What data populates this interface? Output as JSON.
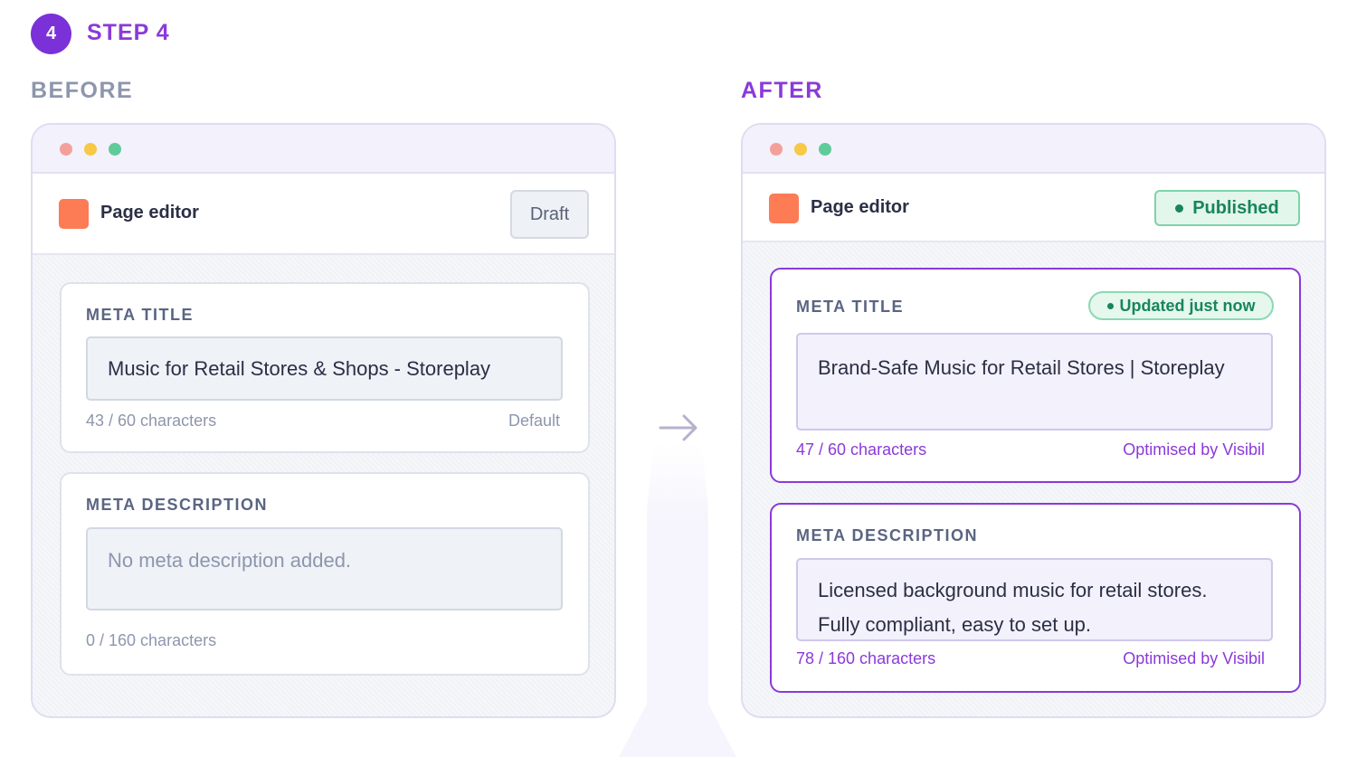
{
  "step": {
    "number": "4",
    "label": "STEP 4"
  },
  "before": {
    "section_label": "BEFORE",
    "editor_title": "Page editor",
    "status": "Draft",
    "meta_title": {
      "label": "META TITLE",
      "value": "Music for Retail Stores & Shops - Storeplay",
      "count": "43 / 60 characters",
      "note": "Default"
    },
    "meta_description": {
      "label": "META DESCRIPTION",
      "placeholder": "No meta description added.",
      "count": "0 / 160 characters"
    }
  },
  "after": {
    "section_label": "AFTER",
    "editor_title": "Page editor",
    "status": "Published",
    "meta_title": {
      "label": "META TITLE",
      "badge": "Updated just now",
      "value": "Brand-Safe Music for Retail Stores | Storeplay",
      "count": "47 / 60 characters",
      "note": "Optimised by Visibil"
    },
    "meta_description": {
      "label": "META DESCRIPTION",
      "line1": "Licensed background music for retail stores.",
      "line2": "Fully compliant, easy to set up.",
      "count": "78 / 160 characters",
      "note": "Optimised by Visibil"
    }
  },
  "colors": {
    "accent": "#8a3ad9",
    "page_icon": "#fd7b55",
    "published_green": "#17865a",
    "window_dot_red": "#f4a09a",
    "window_dot_yellow": "#f7c944",
    "window_dot_green": "#5fcb9b"
  },
  "icons": {
    "transition": "arrow-right-icon"
  }
}
